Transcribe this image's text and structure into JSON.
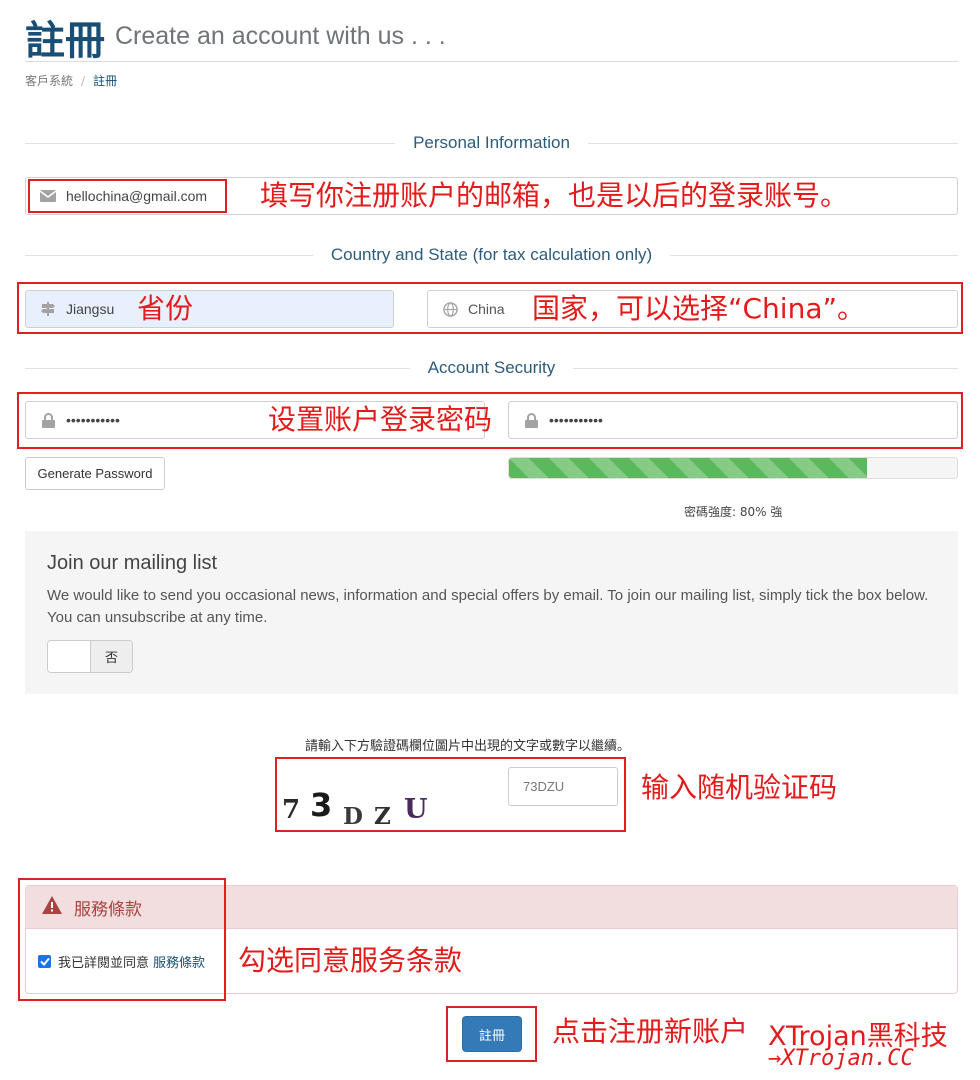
{
  "header": {
    "title": "註冊",
    "subtitle": "Create an account with us . . ."
  },
  "breadcrumb": {
    "home": "客戶系統",
    "separator": "/",
    "current": "註冊"
  },
  "sections": {
    "personal": "Personal Information",
    "country": "Country and State (for tax calculation only)",
    "security": "Account Security"
  },
  "fields": {
    "email": "hellochina@gmail.com",
    "state": "Jiangsu",
    "country": "China",
    "password": "•••••••••••",
    "password_confirm": "•••••••••••"
  },
  "buttons": {
    "generate_password": "Generate Password",
    "register": "註冊"
  },
  "password_strength": {
    "label": "密碼強度: 80% 強",
    "value": 0.8,
    "bar_color": "#5cb85c"
  },
  "mailing": {
    "title": "Join our mailing list",
    "text": "We would like to send you occasional news, information and special offers by email. To join our mailing list, simply tick the box below. You can unsubscribe at any time.",
    "toggle_label": "否"
  },
  "captcha": {
    "instruction": "請輸入下方驗證碼欄位圖片中出現的文字或數字以繼續。",
    "chars": [
      "7",
      "3",
      "D",
      "Z",
      "U"
    ],
    "input_value": "73DZU"
  },
  "tos": {
    "heading": "服務條款",
    "agree_text": "我已詳閱並同意",
    "link_text": "服務條款",
    "checked": true
  },
  "annotations": {
    "email": "填写你注册账户的邮箱，也是以后的登录账号。",
    "state": "省份",
    "country": "国家，可以选择“China”。",
    "password": "设置账户登录密码",
    "captcha": "输入随机验证码",
    "tos": "勾选同意服务条款",
    "register": "点击注册新账户"
  },
  "watermark": {
    "brand": "XTrojan黑科技",
    "site": "→XTrojan.CC"
  },
  "colors": {
    "brand": "#1a4f75",
    "annotation": "#e31b1b",
    "primary": "#337ab7",
    "danger_bg": "#f2dede"
  }
}
